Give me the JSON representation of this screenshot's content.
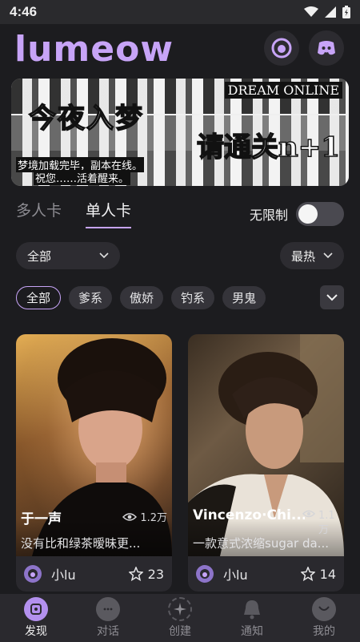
{
  "status_bar": {
    "time": "4:46"
  },
  "header": {
    "logo": "lumeow",
    "accent": "#c7a4f7"
  },
  "banner": {
    "title": "今夜入梦",
    "title2": "请通关n+1",
    "brand": "DREAM ONLINE",
    "subtitle_line1": "梦境加载完毕，副本在线。",
    "subtitle_line2": "祝您……活着醒来。"
  },
  "tabs": [
    {
      "label": "多人卡",
      "active": false
    },
    {
      "label": "单人卡",
      "active": true
    }
  ],
  "toggle": {
    "label": "无限制",
    "on": false
  },
  "filters": {
    "category": "全部",
    "sort": "最热"
  },
  "chips": [
    {
      "label": "全部",
      "active": true
    },
    {
      "label": "爹系",
      "active": false
    },
    {
      "label": "傲娇",
      "active": false
    },
    {
      "label": "钓系",
      "active": false
    },
    {
      "label": "男鬼",
      "active": false
    }
  ],
  "cards": [
    {
      "name": "于一声",
      "views": "1.2万",
      "desc": "没有比和绿茶暧昧更...",
      "author": "小lu",
      "likes": "23"
    },
    {
      "name": "Vincenzo·Chi...",
      "views": "1.1万",
      "desc": "一款意式浓缩sugar da...",
      "author": "小lu",
      "likes": "14"
    }
  ],
  "nav": [
    {
      "label": "发现",
      "icon": "discover-icon",
      "active": true
    },
    {
      "label": "对话",
      "icon": "chat-icon",
      "active": false
    },
    {
      "label": "创建",
      "icon": "create-icon",
      "active": false
    },
    {
      "label": "通知",
      "icon": "bell-icon",
      "active": false
    },
    {
      "label": "我的",
      "icon": "profile-icon",
      "active": false
    }
  ]
}
